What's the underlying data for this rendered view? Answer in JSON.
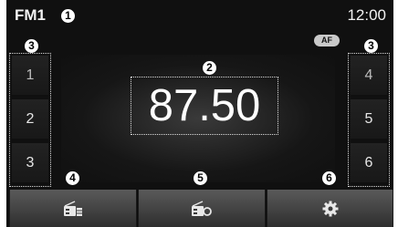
{
  "status_bar": {
    "band": "FM1",
    "time": "12:00"
  },
  "af_badge": "AF",
  "frequency": "87.50",
  "presets_left": [
    "1",
    "2",
    "3"
  ],
  "presets_right": [
    "4",
    "5",
    "6"
  ],
  "callouts": [
    "1",
    "2",
    "3",
    "3",
    "4",
    "5",
    "6"
  ],
  "soft_keys": [
    {
      "icon": "radio-list-icon"
    },
    {
      "icon": "radio-search-icon"
    },
    {
      "icon": "gear-icon"
    }
  ],
  "colors": {
    "background": "#101010",
    "text": "#ffffff",
    "button": "#4a4a4a"
  }
}
